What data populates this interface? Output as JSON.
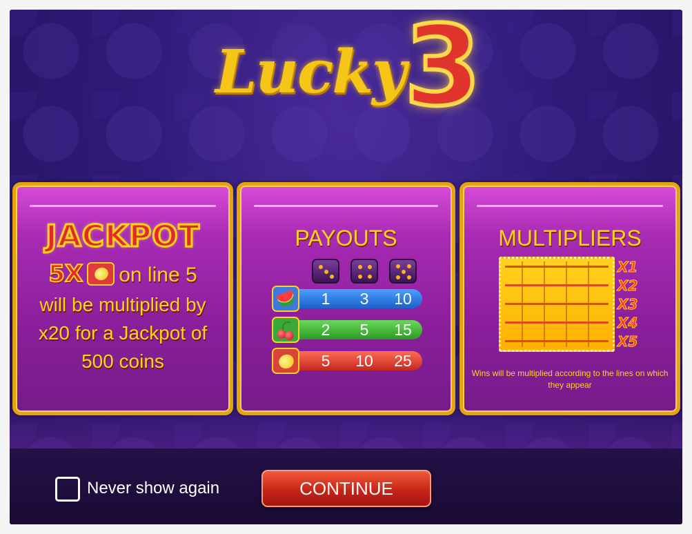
{
  "logo": {
    "word": "Lucky",
    "number": "3"
  },
  "jackpot": {
    "title": "JACKPOT",
    "multiplier": "5X",
    "symbol_icon": "lemon-icon",
    "line_text": "on line 5",
    "body": "will be multiplied by x20 for a Jackpot of 500 coins"
  },
  "payouts": {
    "title": "PAYOUTS",
    "dice_columns": [
      3,
      4,
      5
    ],
    "rows": [
      {
        "symbol": "watermelon-icon",
        "values": [
          "1",
          "3",
          "10"
        ]
      },
      {
        "symbol": "cherry-icon",
        "values": [
          "2",
          "5",
          "15"
        ]
      },
      {
        "symbol": "lemon-icon",
        "values": [
          "5",
          "10",
          "25"
        ]
      }
    ]
  },
  "multipliers": {
    "title": "MULTIPLIERS",
    "labels": [
      "X1",
      "X2",
      "X3",
      "X4",
      "X5"
    ],
    "caption": "Wins will be multiplied according to the lines on which they appear"
  },
  "footer": {
    "checkbox_label": "Never show again",
    "continue_label": "CONTINUE"
  },
  "colors": {
    "accent_gold": "#ffd21f",
    "panel_magenta": "#a82bb4",
    "button_red": "#c92418",
    "background_purple": "#2e1b78"
  }
}
